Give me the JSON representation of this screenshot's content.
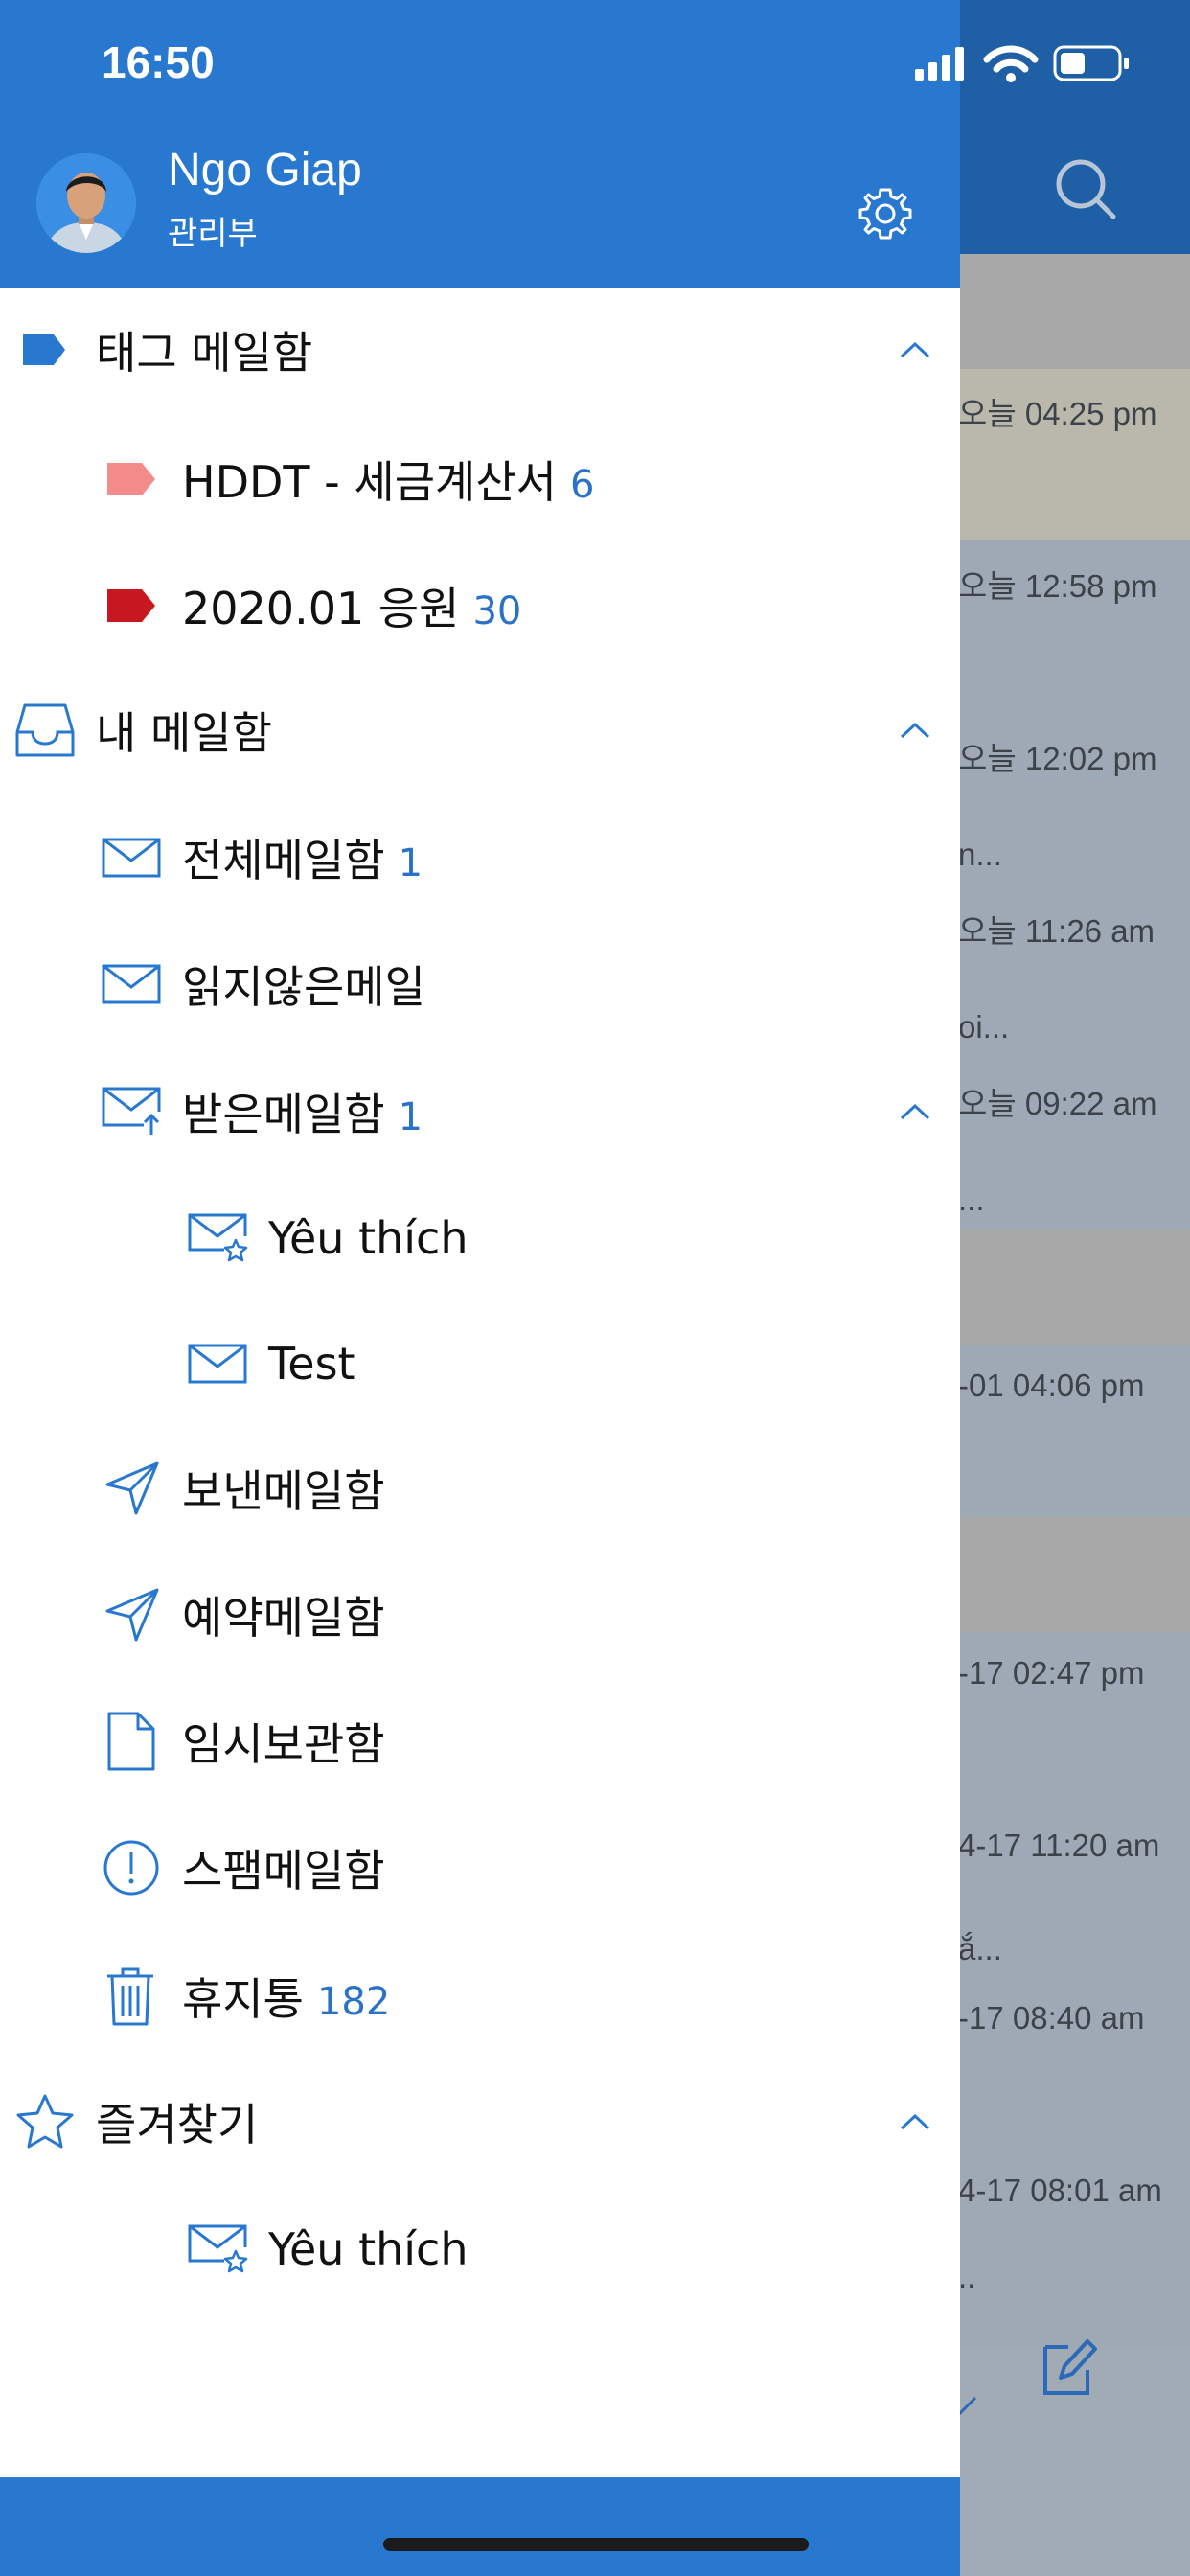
{
  "status_bar": {
    "time": "16:50"
  },
  "user": {
    "name": "Ngo Giap",
    "department": "관리부"
  },
  "sections": [
    {
      "title": "태그 메일함",
      "icon": "tag-icon",
      "items": [
        {
          "label": "HDDT - 세금계산서",
          "count": "6",
          "icon": "tag-pink-icon"
        },
        {
          "label": "2020.01 응원",
          "count": "30",
          "icon": "tag-red-icon"
        }
      ]
    },
    {
      "title": "내 메일함",
      "icon": "inbox-tray-icon",
      "items": [
        {
          "label": "전체메일함",
          "count": "1",
          "icon": "envelope-icon"
        },
        {
          "label": "읽지않은메일",
          "count": "",
          "icon": "envelope-icon"
        },
        {
          "label": "받은메일함",
          "count": "1",
          "icon": "envelope-received-icon",
          "children": [
            {
              "label": "Yêu thích",
              "icon": "envelope-star-icon"
            },
            {
              "label": "Test",
              "icon": "envelope-icon"
            }
          ]
        },
        {
          "label": "보낸메일함",
          "count": "",
          "icon": "paper-plane-icon"
        },
        {
          "label": "예약메일함",
          "count": "",
          "icon": "paper-plane-icon"
        },
        {
          "label": "임시보관함",
          "count": "",
          "icon": "document-icon"
        },
        {
          "label": "스팸메일함",
          "count": "",
          "icon": "exclamation-circle-icon"
        },
        {
          "label": "휴지통",
          "count": "182",
          "icon": "trash-icon"
        }
      ]
    },
    {
      "title": "즐겨찾기",
      "icon": "star-icon",
      "items": [
        {
          "label": "Yêu thích",
          "count": "",
          "icon": "envelope-star-icon"
        }
      ]
    }
  ],
  "background_list": {
    "times": [
      "오늘 04:25 pm",
      "오늘 12:58 pm",
      "오늘 12:02 pm",
      "오늘 11:26 am",
      "오늘 09:22 am",
      "-01 04:06 pm",
      "-17 02:47 pm",
      "4-17 11:20 am",
      "-17 08:40 am",
      "4-17 08:01 am"
    ],
    "snippets": [
      "n...",
      "oi...",
      "...",
      "ắ...",
      " .."
    ]
  },
  "colors": {
    "drawer_header": "#2878cf",
    "accent": "#2a72c8",
    "tag_pink": "#f48b8b",
    "tag_red": "#c8181f"
  }
}
